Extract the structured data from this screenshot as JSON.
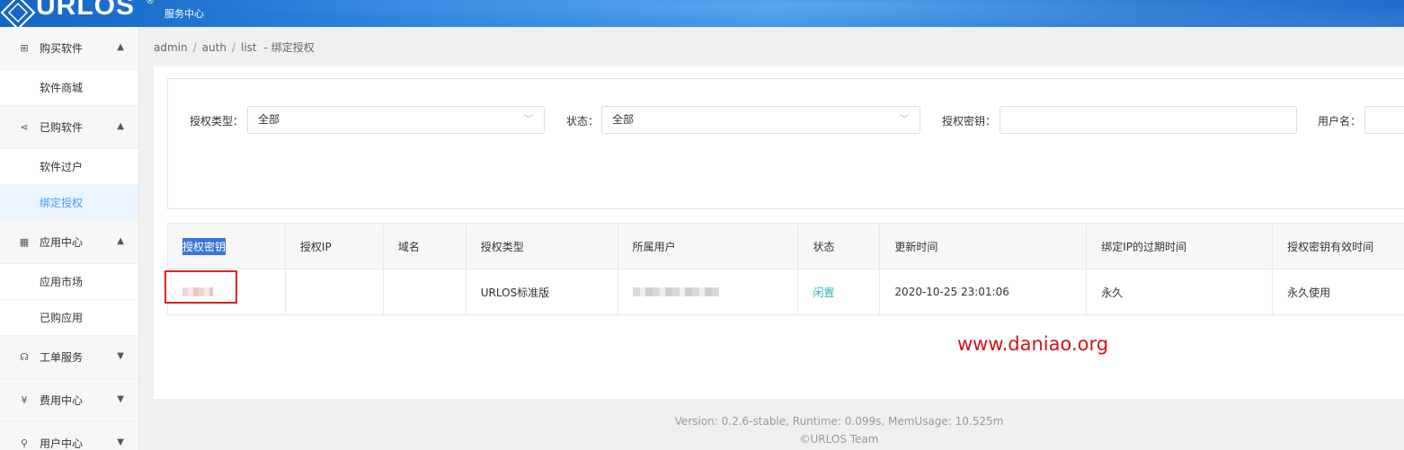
{
  "header": {
    "logo": "URLOS",
    "reg": "®",
    "subtitle": "服务中心"
  },
  "sidebar": {
    "groups": [
      {
        "label": "购买软件",
        "icon": "store-icon",
        "glyph": "⊞",
        "chevron": "▲",
        "items": [
          {
            "label": "软件商城",
            "active": false
          }
        ]
      },
      {
        "label": "已购软件",
        "icon": "share-icon",
        "glyph": "⋖",
        "chevron": "▲",
        "items": [
          {
            "label": "软件过户",
            "active": false
          },
          {
            "label": "绑定授权",
            "active": true
          }
        ]
      },
      {
        "label": "应用中心",
        "icon": "grid-icon",
        "glyph": "▦",
        "chevron": "▲",
        "items": [
          {
            "label": "应用市场",
            "active": false
          },
          {
            "label": "已购应用",
            "active": false
          }
        ]
      },
      {
        "label": "工单服务",
        "icon": "headset-icon",
        "glyph": "☊",
        "chevron": "▼",
        "items": []
      },
      {
        "label": "费用中心",
        "icon": "yen-icon",
        "glyph": "¥",
        "chevron": "▼",
        "items": []
      },
      {
        "label": "用户中心",
        "icon": "user-icon",
        "glyph": "⚲",
        "chevron": "▼",
        "items": []
      }
    ]
  },
  "breadcrumb": {
    "p1": "admin",
    "p2": "auth",
    "p3": "list",
    "sep": "/",
    "dash": "-",
    "current": "绑定授权"
  },
  "filters": {
    "type_label": "授权类型：",
    "type_value": "全部",
    "status_label": "状态：",
    "status_value": "全部",
    "key_label": "授权密钥：",
    "key_value": "",
    "user_label": "用户名：",
    "user_value": "",
    "arrow": "﹀"
  },
  "table": {
    "headers": [
      "授权密钥",
      "授权IP",
      "域名",
      "授权类型",
      "所属用户",
      "状态",
      "更新时间",
      "绑定IP的过期时间",
      "授权密钥有效时间"
    ],
    "row": {
      "key": "",
      "ip": "",
      "domain": "",
      "type": "URLOS标准版",
      "user": "",
      "status": "闲置",
      "updated": "2020-10-25 23:01:06",
      "ip_expire": "永久",
      "key_valid": "永久使用"
    }
  },
  "watermark": "www.daniao.org",
  "footer": {
    "line1": "Version: 0.2.6-stable,    Runtime: 0.099s,    MemUsage: 10.525m",
    "line2": "©URLOS Team"
  },
  "colors": {
    "accent": "#409eff",
    "header": "#2f86e0",
    "status": "#2bb5b5",
    "highlight": "#e02222"
  }
}
